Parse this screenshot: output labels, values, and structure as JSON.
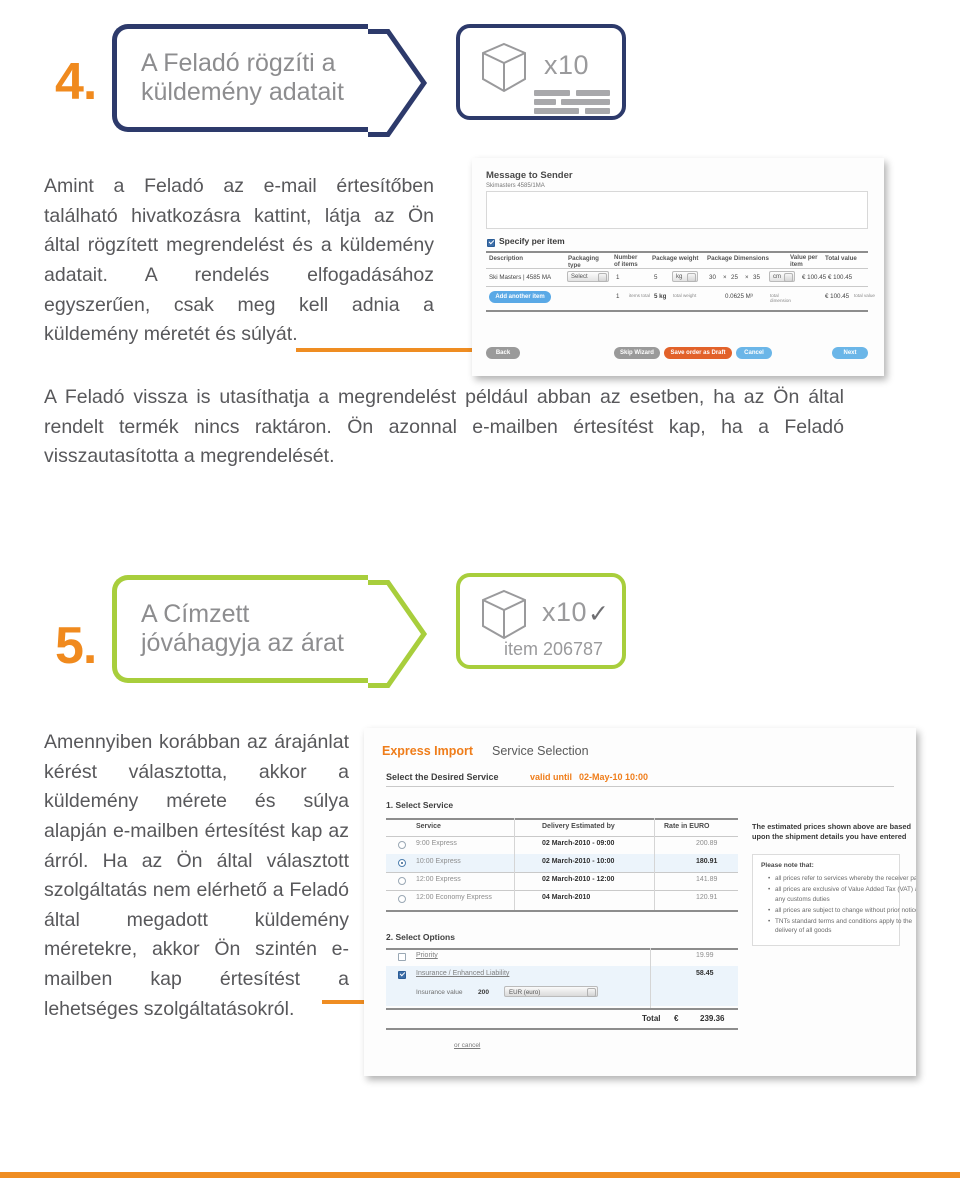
{
  "page": {
    "colors": {
      "orange": "#ef8d22",
      "navy": "#2d3a6b",
      "green": "#a8ce3c",
      "body_text": "#58585b",
      "callout_text": "#8d8d8f"
    }
  },
  "step4": {
    "number": "4.",
    "callout_text": "A Feladó rögzíti a\nküldemény adatait",
    "box": {
      "qty": "x10",
      "icon": "package-box-icon"
    },
    "paragraph": "Amint a Feladó az e-mail értesítőben található hivatkozásra kattint, látja az Ön által rögzített megrendelést és a küldemény adatait. A rendelés elfogadásához egyszerűen, csak meg kell adnia a küldemény méretét és súlyát.",
    "paragraph2": "A Feladó vissza is utasíthatja a megrendelést például abban az esetben, ha az Ön által rendelt termék nincs raktáron. Ön azonnal e-mailben értesítést kap, ha a Feladó visszautasította a megrendelését."
  },
  "step5": {
    "number": "5.",
    "callout_text": "A Címzett\njóváhagyja az árat",
    "box": {
      "qty": "x10",
      "check": "✓",
      "item_id": "item 206787",
      "icon": "package-box-icon"
    },
    "paragraph": "Amennyiben korábban az árajánlat kérést választotta, akkor a küldemény mérete és súlya alapján e-mailben értesítést kap az árról. Ha az Ön által választott szolgáltatás nem elérhető a Feladó által megadott küldemény méretekre, akkor Ön szintén e-mailben kap értesítést a lehetséges szolgáltatásokról."
  },
  "shot1": {
    "title": "Message to Sender",
    "subtitle": "Skimasters 4585/1MA",
    "message_value": "",
    "specify_checkbox_label": "Specify per item",
    "specify_checked": true,
    "table": {
      "headers": [
        "Description",
        "Packaging type",
        "Number of items",
        "Package weight",
        "Package Dimensions",
        "Value per item",
        "Total value"
      ],
      "row": {
        "description": "Ski Masters | 4585 MA",
        "packaging_type": "Select",
        "number_of_items": "1",
        "package_weight": "5",
        "weight_unit": "kg",
        "dim_l": "30",
        "dim_w": "25",
        "dim_h": "35",
        "dim_unit": "cm",
        "value_per_item": "€  100.45",
        "total_value": "€  100.45"
      },
      "totals": {
        "items_total": "1",
        "items_total_label": "items total",
        "weight_total": "5 kg",
        "weight_total_label": "total weight",
        "dimension_total": "0.0625 M³",
        "dimension_total_label": "total dimension",
        "value_total": "€  100.45",
        "value_total_label": "total value"
      }
    },
    "add_item_button": "Add another item",
    "buttons": {
      "back": "Back",
      "skip_wizard": "Skip Wizard",
      "save_draft": "Save order as Draft",
      "cancel": "Cancel",
      "next": "Next"
    }
  },
  "shot2": {
    "brand": "Express Import",
    "page_title": "Service Selection",
    "select_desired": "Select the Desired Service",
    "valid_until_label": "valid until",
    "valid_until_value": "02-May-10 10:00",
    "section1": "1. Select Service",
    "service_headers": [
      "Service",
      "Delivery Estimated by",
      "Rate in EURO"
    ],
    "services": [
      {
        "name": "9:00 Express",
        "eta": "02 March-2010 - 09:00",
        "rate": "200.89",
        "selected": false
      },
      {
        "name": "10:00 Express",
        "eta": "02 March-2010 - 10:00",
        "rate": "180.91",
        "selected": true
      },
      {
        "name": "12:00 Express",
        "eta": "02 March-2010 - 12:00",
        "rate": "141.89",
        "selected": false
      },
      {
        "name": "12:00 Economy Express",
        "eta": "04 March-2010",
        "rate": "120.91",
        "selected": false
      }
    ],
    "section2": "2. Select Options",
    "options": [
      {
        "name": "Priority",
        "price": "19.99",
        "checked": false
      },
      {
        "name": "Insurance / Enhanced Liability",
        "price": "58.45",
        "checked": true
      }
    ],
    "insurance_value_label": "Insurance value",
    "insurance_value": "200",
    "insurance_currency": "EUR (euro)",
    "total_label": "Total",
    "total_currency": "€",
    "total_value": "239.36",
    "cancel_link": "or cancel",
    "note_title": "The estimated prices shown above are based upon the shipment details you have entered",
    "note_head": "Please note that:",
    "note_items": [
      "all prices refer to services whereby the receiver pays",
      "all prices are exclusive of Value Added Tax (VAT) and any customs duties",
      "all prices are subject to change without prior notice",
      "TNTs standard terms and conditions apply to the delivery of all goods"
    ]
  }
}
